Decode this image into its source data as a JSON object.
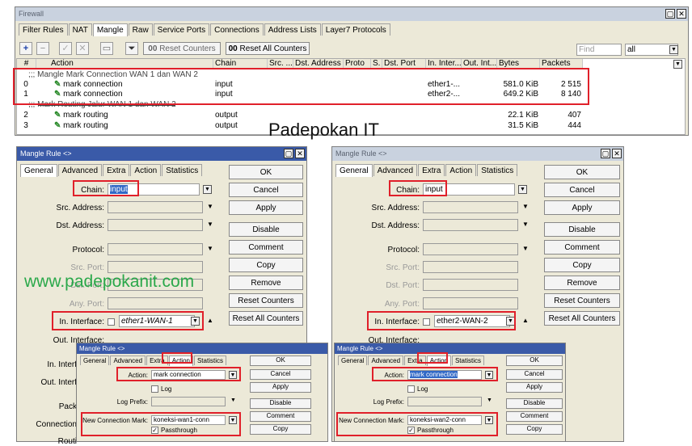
{
  "firewall": {
    "title": "Firewall",
    "tabs": [
      "Filter Rules",
      "NAT",
      "Mangle",
      "Raw",
      "Service Ports",
      "Connections",
      "Address Lists",
      "Layer7 Protocols"
    ],
    "toolbar": {
      "reset_counters": "Reset Counters",
      "reset_all_counters": "Reset All Counters",
      "find_placeholder": "Find",
      "filter_value": "all"
    },
    "columns": [
      "#",
      "Action",
      "Chain",
      "Src. ...",
      "Dst. Address",
      "Proto",
      "S.",
      "Dst. Port",
      "In. Inter...",
      "Out. Int...",
      "Bytes",
      "Packets"
    ],
    "comment1": ";;; Mangle Mark Connection WAN 1 dan WAN 2",
    "comment2": ";;; Mark Routing Jalur WAN 1 dan WAN 2",
    "rows": [
      {
        "n": "0",
        "action": "mark connection",
        "chain": "input",
        "in": "ether1-...",
        "bytes": "581.0 KiB",
        "packets": "2 515"
      },
      {
        "n": "1",
        "action": "mark connection",
        "chain": "input",
        "in": "ether2-...",
        "bytes": "649.2 KiB",
        "packets": "8 140"
      },
      {
        "n": "2",
        "action": "mark routing",
        "chain": "output",
        "in": "",
        "bytes": "22.1 KiB",
        "packets": "407"
      },
      {
        "n": "3",
        "action": "mark routing",
        "chain": "output",
        "in": "",
        "bytes": "31.5 KiB",
        "packets": "444"
      }
    ]
  },
  "watermark": {
    "title": "Padepokan IT",
    "url": "www.padepokanit.com"
  },
  "rule": {
    "title": "Mangle Rule <>",
    "tabs": [
      "General",
      "Advanced",
      "Extra",
      "Action",
      "Statistics"
    ],
    "labels": {
      "chain": "Chain:",
      "src": "Src. Address:",
      "dst": "Dst. Address:",
      "protocol": "Protocol:",
      "src_port": "Src. Port:",
      "dst_port": "Dst. Port:",
      "any_port": "Any. Port:",
      "in_iface": "In. Interface:",
      "out_iface": "Out. Interface:",
      "in_iface_short": "In. Interf",
      "out_iface_short": "Out. Interf",
      "pack": "Pack",
      "conn": "Connection",
      "rout": "Routi"
    },
    "buttons": [
      "OK",
      "Cancel",
      "Apply",
      "Disable",
      "Comment",
      "Copy",
      "Remove",
      "Reset Counters",
      "Reset All Counters"
    ],
    "left": {
      "chain": "input",
      "in_iface": "ether1-WAN-1"
    },
    "right": {
      "chain": "input",
      "in_iface": "ether2-WAN-2"
    }
  },
  "action_rule": {
    "title": "Mangle Rule <>",
    "tabs": [
      "General",
      "Advanced",
      "Extra",
      "Action",
      "Statistics"
    ],
    "labels": {
      "action": "Action:",
      "log": "Log",
      "log_prefix": "Log Prefix:",
      "new_conn_mark": "New Connection Mark:",
      "passthrough": "Passthrough"
    },
    "buttons": [
      "OK",
      "Cancel",
      "Apply",
      "Disable",
      "Comment",
      "Copy"
    ],
    "left": {
      "action": "mark connection",
      "mark": "koneksi-wan1-conn"
    },
    "right": {
      "action": "mark connection",
      "mark": "koneksi-wan2-conn"
    }
  }
}
